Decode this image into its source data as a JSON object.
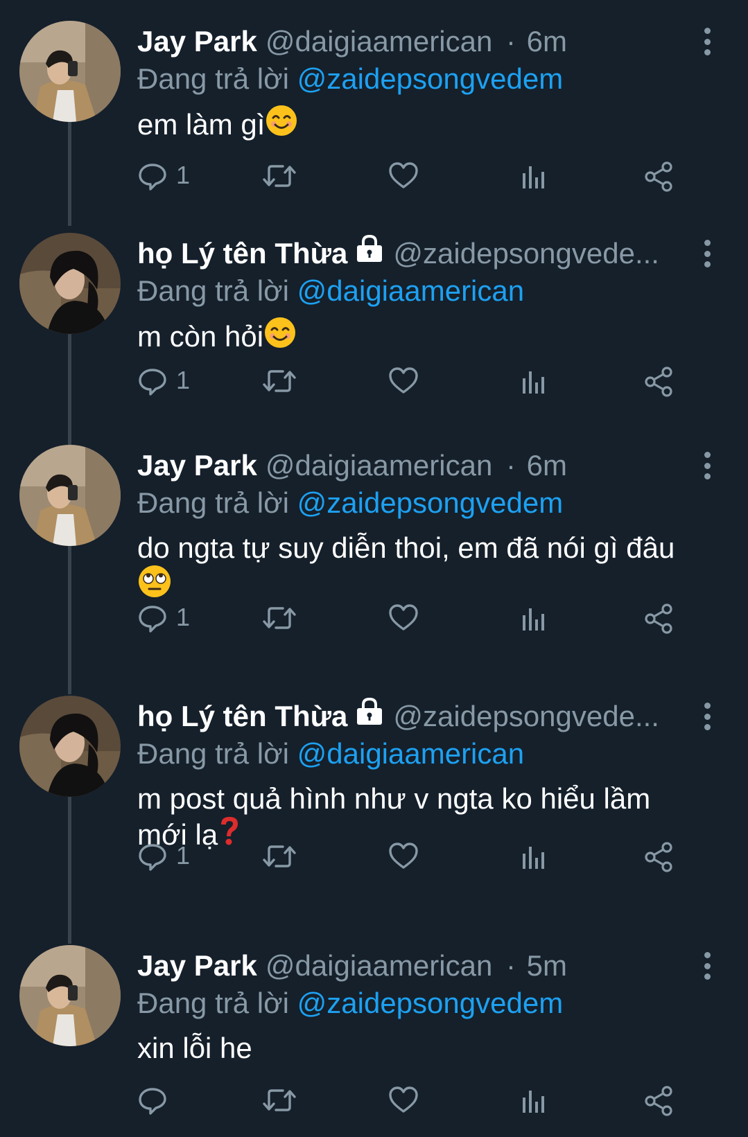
{
  "colors": {
    "background": "#15202b",
    "secondary_text": "#8899a6",
    "mention": "#1da1f2",
    "thread_line": "#38444d"
  },
  "tweets": [
    {
      "name": "Jay Park",
      "handle": "@daigiaamerican",
      "time_sep": "·",
      "time": "6m",
      "reply_prefix": "Đang trả lời",
      "reply_to": "@zaidepsongvedem",
      "text_line1": "em làm gì",
      "text_line2": "",
      "emoji": "smiling-face-icon",
      "reply_count": "1",
      "protected": false,
      "avatar": "avatar-jay-park"
    },
    {
      "name": "họ Lý tên Thừa",
      "handle": "@zaidepsongvede...",
      "time_sep": "",
      "time": "",
      "reply_prefix": "Đang trả lời",
      "reply_to": "@daigiaamerican",
      "text_line1": "m còn hỏi",
      "text_line2": "",
      "emoji": "smiling-face-icon",
      "reply_count": "1",
      "protected": true,
      "avatar": "avatar-ho-ly-ten-thua"
    },
    {
      "name": "Jay Park",
      "handle": "@daigiaamerican",
      "time_sep": "·",
      "time": "6m",
      "reply_prefix": "Đang trả lời",
      "reply_to": "@zaidepsongvedem",
      "text_line1": "do ngta tự suy diễn thoi, em đã nói gì đâu",
      "text_line2": "",
      "emoji": "eye-roll-face-icon",
      "reply_count": "1",
      "protected": false,
      "avatar": "avatar-jay-park"
    },
    {
      "name": "họ Lý tên Thừa",
      "handle": "@zaidepsongvede...",
      "time_sep": "",
      "time": "",
      "reply_prefix": "Đang trả lời",
      "reply_to": "@daigiaamerican",
      "text_line1": "m post quả hình như v ngta ko hiểu lầm",
      "text_line2": "mới lạ",
      "emoji": "red-question-mark-icon",
      "reply_count": "1",
      "protected": true,
      "avatar": "avatar-ho-ly-ten-thua"
    },
    {
      "name": "Jay Park",
      "handle": "@daigiaamerican",
      "time_sep": "·",
      "time": "5m",
      "reply_prefix": "Đang trả lời",
      "reply_to": "@zaidepsongvedem",
      "text_line1": "xin lỗi he",
      "text_line2": "",
      "emoji": "",
      "reply_count": "",
      "protected": false,
      "avatar": "avatar-jay-park"
    }
  ],
  "action_icons": [
    "reply-icon",
    "retweet-icon",
    "like-icon",
    "analytics-icon",
    "share-icon"
  ]
}
